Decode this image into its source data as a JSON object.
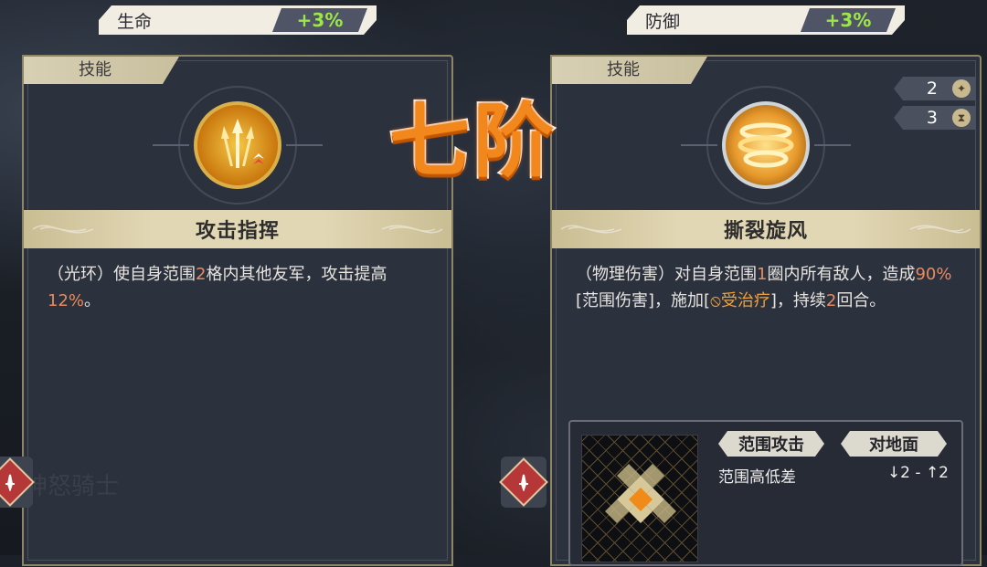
{
  "left_stat": {
    "label": "生命",
    "value": "+3%"
  },
  "right_stat": {
    "label": "防御",
    "value": "+3%"
  },
  "overlay_title": "七阶",
  "left_card": {
    "tag": "技能",
    "skill_name": "攻击指挥",
    "desc_parts": [
      "（光环）使自身范围",
      "2",
      "格内其他友军，攻击提高",
      "12%",
      "。"
    ],
    "ghost_text": "神怒骑士"
  },
  "right_card": {
    "tag": "技能",
    "skill_name": "撕裂旋风",
    "counters": [
      {
        "value": "2",
        "icon": "sparkle-icon"
      },
      {
        "value": "3",
        "icon": "hourglass-icon"
      }
    ],
    "desc_parts": [
      "（物理伤害）对自身范围",
      "1",
      "圈内所有敌人，造成",
      "90%",
      "[范围伤害]，施加[",
      "受治疗",
      "]，持续",
      "2",
      "回合。"
    ],
    "range": {
      "tag1": "范围攻击",
      "tag2": "对地面",
      "label": "范围高低差",
      "value": "↓2 - ↑2"
    }
  },
  "colors": {
    "highlight": "#e98a5f",
    "stat_value": "#9de64a",
    "title_orange": "#f2881c",
    "heal_debuff": "#f0a23c"
  }
}
